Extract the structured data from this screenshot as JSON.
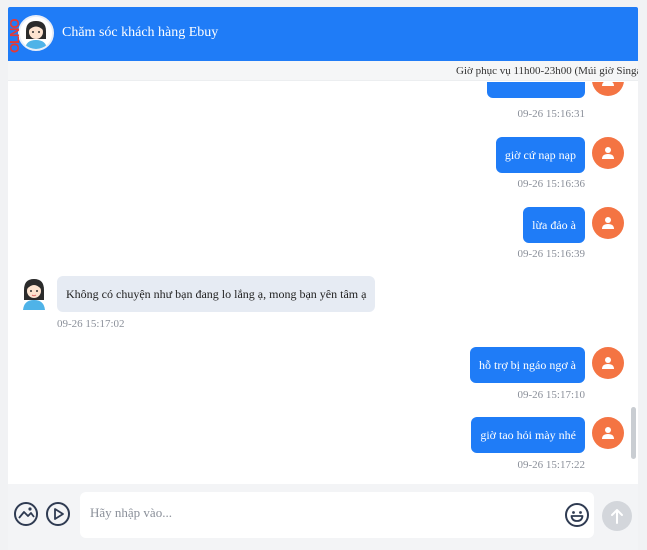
{
  "header": {
    "title": "Chăm sóc khách hàng Ebuy",
    "badge": "OLNO"
  },
  "service_hours": "Giờ phục vụ 11h00-23h00 (Múi giờ Singa",
  "messages": [
    {
      "from": "user",
      "text": "",
      "time": "09-26 15:16:31"
    },
    {
      "from": "user",
      "text": "giờ cứ nạp nạp",
      "time": "09-26 15:16:36"
    },
    {
      "from": "user",
      "text": "lừa đảo à",
      "time": "09-26 15:16:39"
    },
    {
      "from": "agent",
      "text": "Không có chuyện như bạn đang lo lắng ạ, mong bạn yên tâm ạ",
      "time": "09-26 15:17:02"
    },
    {
      "from": "user",
      "text": "hỗ trợ bị ngáo ngơ à",
      "time": "09-26 15:17:10"
    },
    {
      "from": "user",
      "text": "giờ tao hỏi mày nhé",
      "time": "09-26 15:17:22"
    },
    {
      "from": "user",
      "text": "",
      "time": ""
    }
  ],
  "composer": {
    "placeholder": "Hãy nhập vào..."
  },
  "colors": {
    "primary": "#1f7cf7",
    "user_avatar": "#f47443",
    "agent_bubble": "#e6ebf3"
  },
  "icons": [
    "image-icon",
    "video-icon",
    "emoji-icon",
    "send-icon",
    "user-icon",
    "agent-avatar"
  ]
}
